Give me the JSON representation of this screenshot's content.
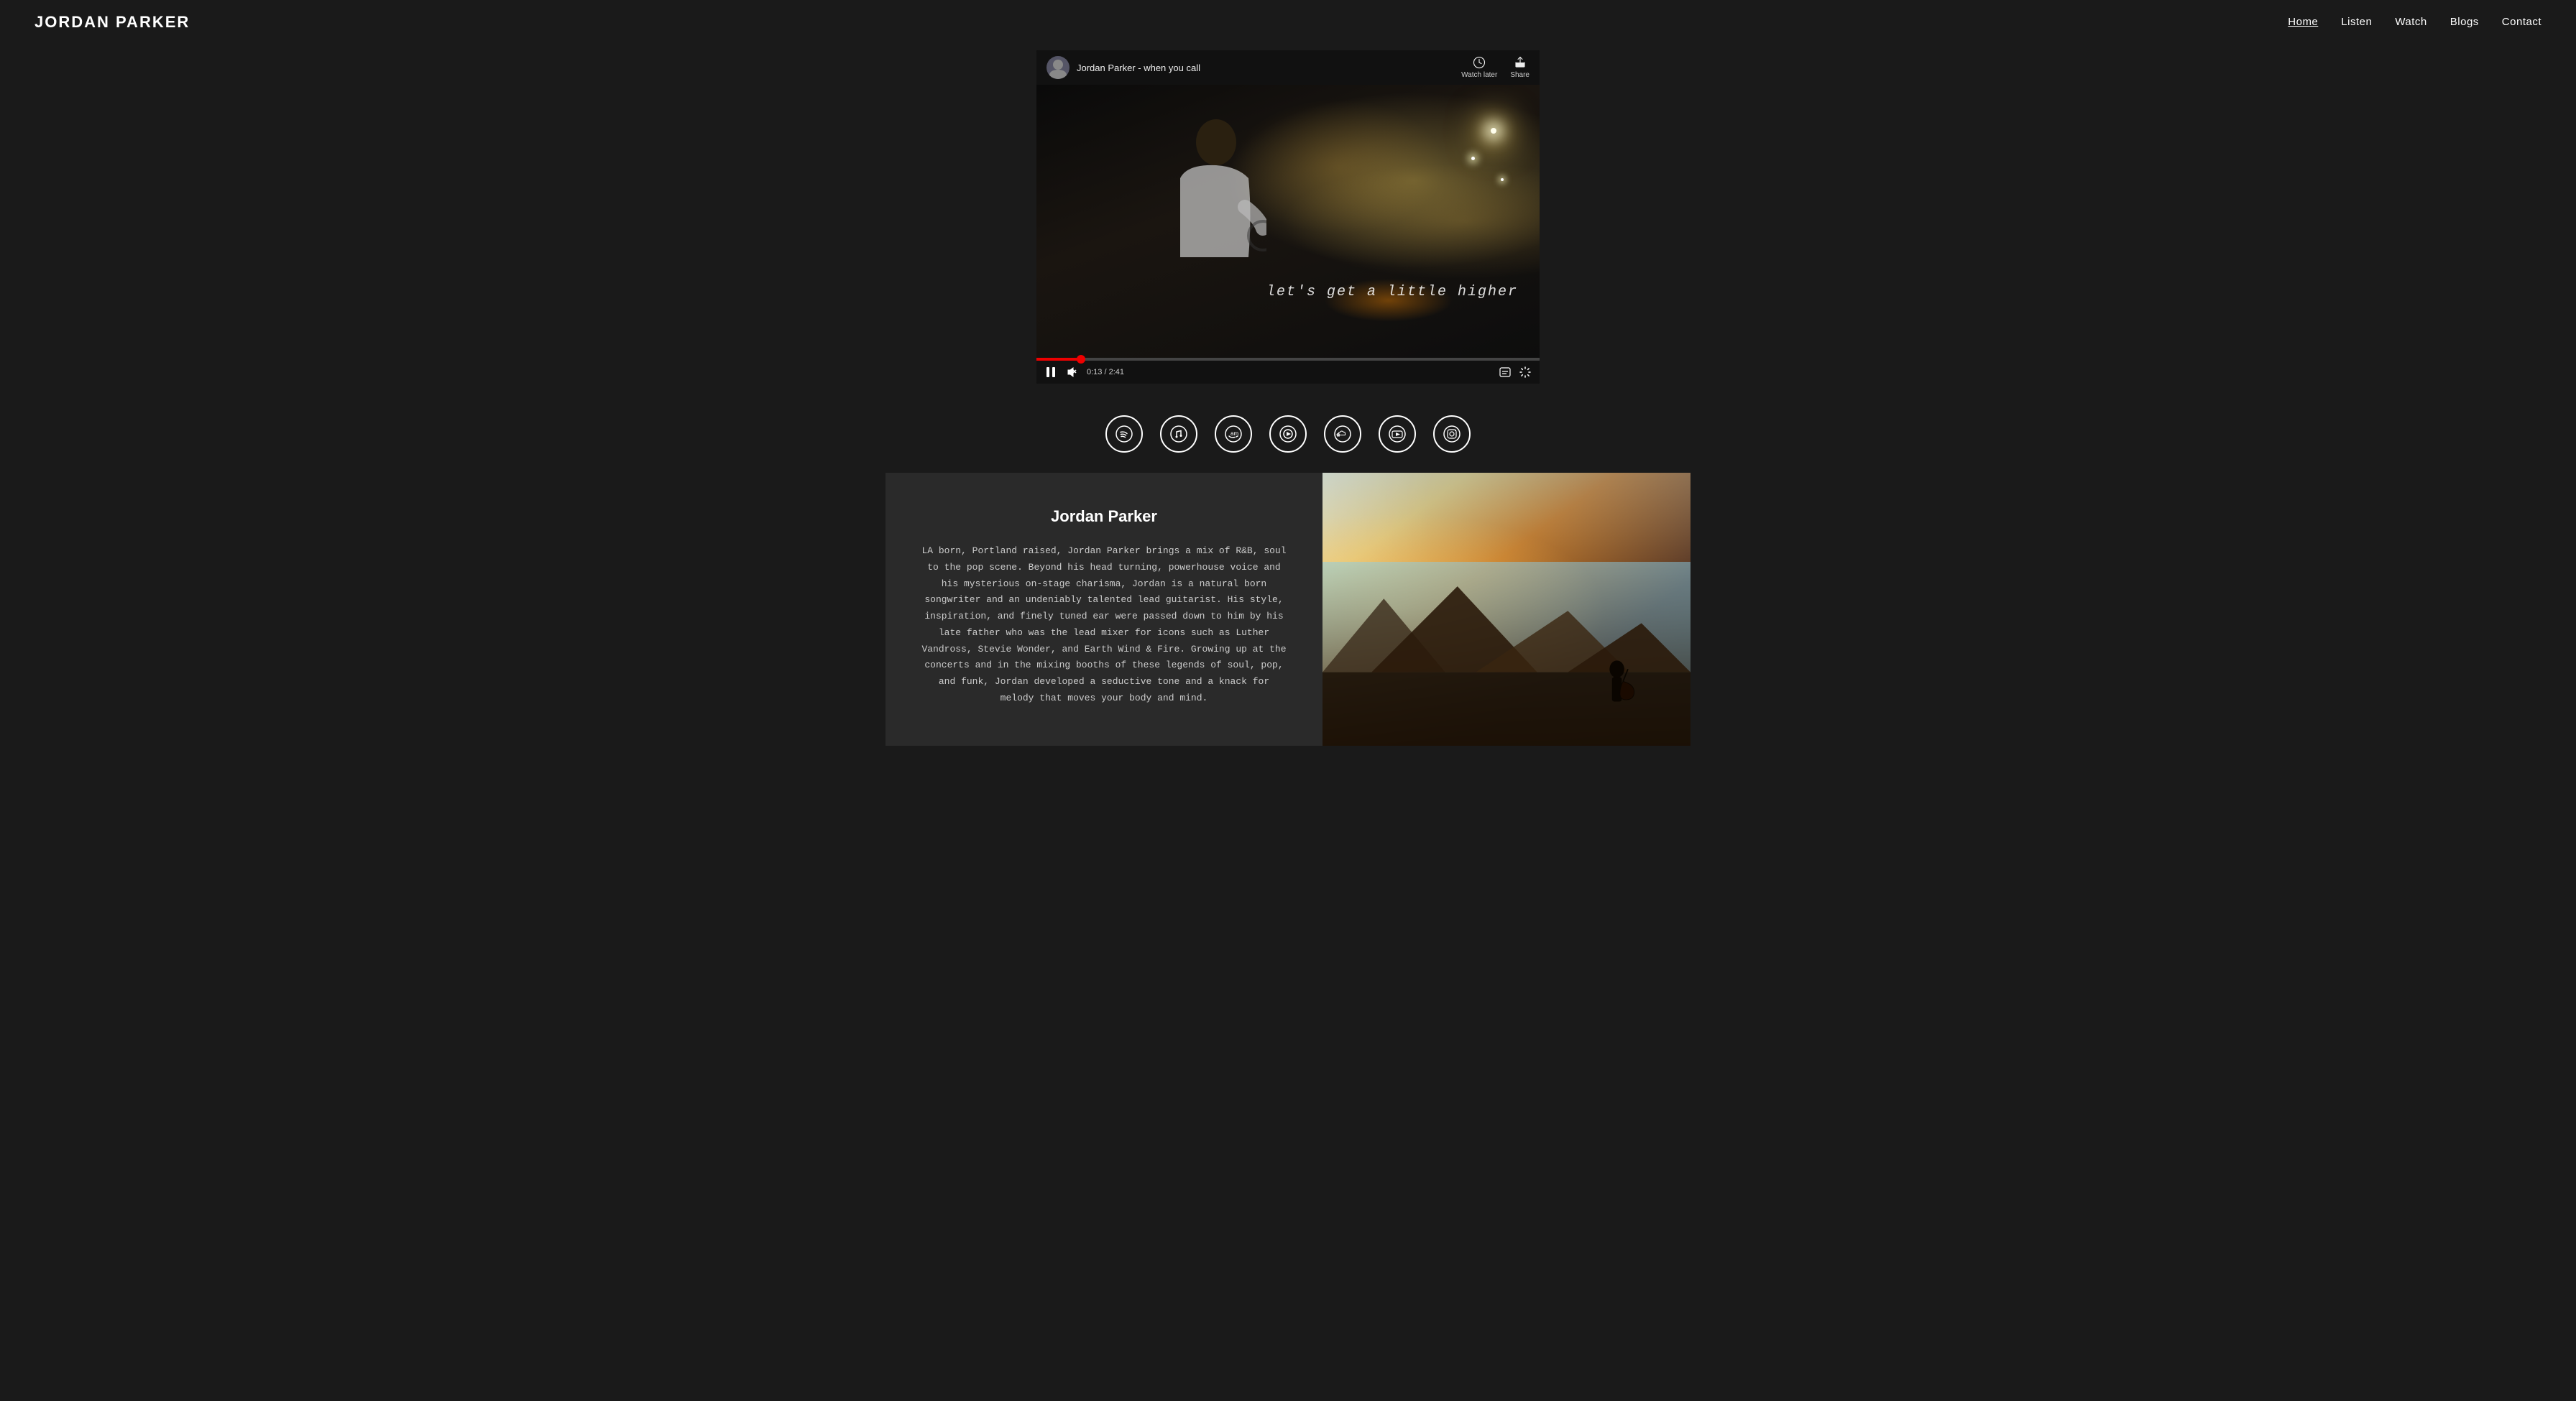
{
  "nav": {
    "logo": "JORDAN PARKER",
    "links": [
      {
        "label": "Home",
        "active": true
      },
      {
        "label": "Listen",
        "active": false
      },
      {
        "label": "Watch",
        "active": false
      },
      {
        "label": "Blogs",
        "active": false
      },
      {
        "label": "Contact",
        "active": false
      }
    ]
  },
  "video": {
    "channel_name": "Jordan Parker",
    "video_title": "Jordan Parker - when you call",
    "watch_later_label": "Watch later",
    "share_label": "Share",
    "lyrics": "let's get a little higher",
    "time_current": "0:13",
    "time_total": "2:41",
    "progress_percent": 8
  },
  "social": {
    "icons": [
      {
        "name": "spotify-icon",
        "symbol": "Ⓢ",
        "label": "Spotify"
      },
      {
        "name": "apple-music-icon",
        "symbol": "",
        "label": "Apple Music"
      },
      {
        "name": "amazon-music-icon",
        "symbol": "",
        "label": "Amazon Music"
      },
      {
        "name": "play-icon",
        "symbol": "▶",
        "label": "Play"
      },
      {
        "name": "soundcloud-icon",
        "symbol": "☁",
        "label": "SoundCloud"
      },
      {
        "name": "youtube-icon",
        "symbol": "▶",
        "label": "YouTube"
      },
      {
        "name": "instagram-icon",
        "symbol": "◎",
        "label": "Instagram"
      }
    ]
  },
  "bio": {
    "name": "Jordan Parker",
    "text": "LA born, Portland raised, Jordan Parker brings a mix of R&B, soul to the pop scene. Beyond his head turning, powerhouse voice and his mysterious on-stage charisma, Jordan is a natural born songwriter and an undeniably talented lead guitarist. His style, inspiration, and finely tuned ear were passed down to him by his late father who was the lead mixer for icons such as Luther Vandross, Stevie Wonder, and Earth Wind & Fire. Growing up at the concerts and in the mixing booths of these legends of soul, pop, and funk, Jordan developed a seductive tone and a knack for melody that moves your body and mind."
  }
}
